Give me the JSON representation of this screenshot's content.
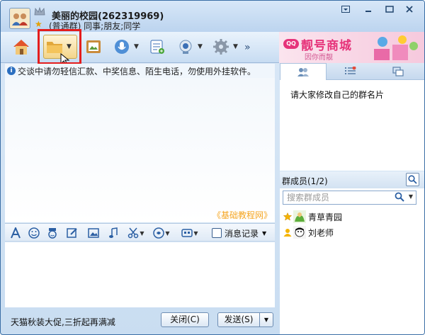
{
  "group": {
    "name": "美丽的校园(262319969)",
    "subtitle": "(普通群) 同事;朋友;同学"
  },
  "window_controls": {
    "menu": "▾",
    "minimize": "_",
    "close": "✕"
  },
  "toolbar": {
    "more": "»",
    "highlighted_button": "share-folder-button"
  },
  "ad": {
    "logo": "QQ",
    "title": "靓号商城",
    "subtitle": "因你而靓",
    "art": "5 2 0"
  },
  "chat": {
    "notice": "交谈中请勿轻信汇款、中奖信息、陌生电话，勿使用外挂软件。",
    "watermark": "《基础教程网》",
    "history_label": "消息记录",
    "promo_text": "天猫秋装大促,三折起再满减",
    "close_button": "关闭(C)",
    "send_button": "发送(S)"
  },
  "right_panel": {
    "announcement": "请大家修改自己的群名片",
    "members_label": "群成员(1/2)",
    "search_placeholder": "搜索群成员",
    "members": [
      {
        "name": "青草青园",
        "role": "owner"
      },
      {
        "name": "刘老师",
        "role": "admin"
      }
    ]
  },
  "colors": {
    "highlight": "#e41d1d",
    "accent": "#3a6ea5",
    "ad_pink": "#e6337a",
    "watermark": "#f5a623"
  }
}
